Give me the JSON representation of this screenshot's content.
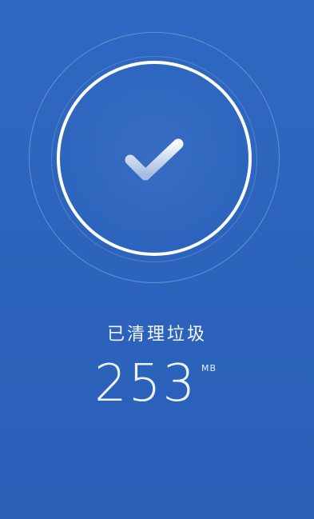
{
  "result": {
    "status_icon": "checkmark-icon",
    "label": "已清理垃圾",
    "value": "253",
    "unit": "MB"
  },
  "colors": {
    "background": "#2c63bc",
    "ring": "#ffffff"
  }
}
